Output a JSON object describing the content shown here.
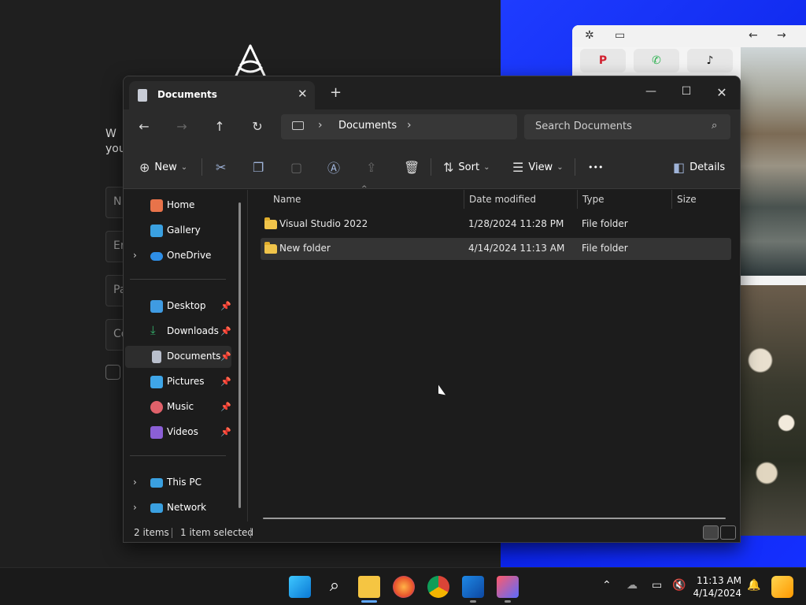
{
  "window": {
    "tab_title": "Documents",
    "tab_close_glyph": "✕",
    "new_tab_glyph": "+",
    "minimize_glyph": "—",
    "maximize_glyph": "☐",
    "close_glyph": "✕"
  },
  "navigation": {
    "back_glyph": "←",
    "forward_glyph": "→",
    "up_glyph": "↑",
    "refresh_glyph": "↻",
    "breadcrumb_current": "Documents",
    "search_placeholder": "Search Documents"
  },
  "toolbar": {
    "new_label": "New",
    "sort_label": "Sort",
    "view_label": "View",
    "more_glyph": "•••",
    "details_label": "Details"
  },
  "sidebar": {
    "items": [
      {
        "label": "Home",
        "icon": "home-icon",
        "color": "#e8734a"
      },
      {
        "label": "Gallery",
        "icon": "gallery-icon",
        "color": "#3aa0e0"
      },
      {
        "label": "OneDrive",
        "icon": "cloud-icon",
        "color": "#2e8ee6"
      },
      {
        "label": "Desktop",
        "icon": "desktop-icon",
        "color": "#3f9be2"
      },
      {
        "label": "Downloads",
        "icon": "download-icon",
        "color": "#34b26c"
      },
      {
        "label": "Documents",
        "icon": "document-icon",
        "color": "#b9bfcc"
      },
      {
        "label": "Pictures",
        "icon": "pictures-icon",
        "color": "#3fa6e8"
      },
      {
        "label": "Music",
        "icon": "music-icon",
        "color": "#e0616a"
      },
      {
        "label": "Videos",
        "icon": "videos-icon",
        "color": "#8b5fd6"
      },
      {
        "label": "This PC",
        "icon": "pc-icon",
        "color": "#3aa0e0"
      },
      {
        "label": "Network",
        "icon": "network-icon",
        "color": "#3aa0e0"
      }
    ],
    "selected": "Documents"
  },
  "columns": [
    "Name",
    "Date modified",
    "Type",
    "Size"
  ],
  "files": [
    {
      "name": "Visual Studio 2022",
      "date": "1/28/2024 11:28 PM",
      "type": "File folder",
      "size": ""
    },
    {
      "name": "New folder",
      "date": "4/14/2024 11:13 AM",
      "type": "File folder",
      "size": ""
    }
  ],
  "status": {
    "count": "2 items",
    "selected": "1 item selected"
  },
  "taskbar": {
    "time": "11:13 AM",
    "date": "4/14/2024"
  },
  "background": {
    "letters": [
      "W",
      "you",
      "N",
      "Er",
      "Pa",
      "Co"
    ]
  }
}
